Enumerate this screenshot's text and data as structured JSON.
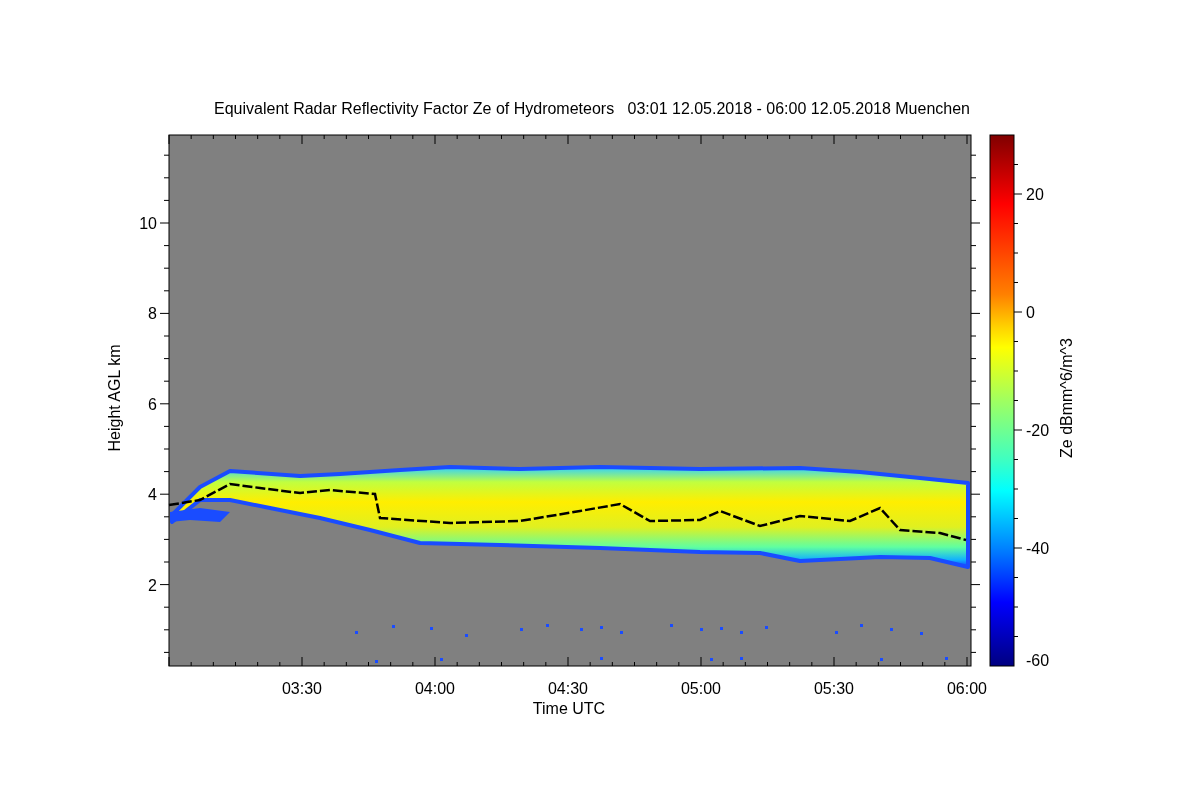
{
  "title": "Equivalent Radar Reflectivity Factor Ze of Hydrometeors   03:01 12.05.2018 - 06:00 12.05.2018 Muenchen",
  "x_axis": {
    "label": "Time UTC",
    "ticks": [
      "03:30",
      "04:00",
      "04:30",
      "05:00",
      "05:30",
      "06:00"
    ]
  },
  "y_axis": {
    "label": "Height AGL km",
    "ticks": [
      "10",
      "8",
      "6",
      "4",
      "2"
    ]
  },
  "colorbar": {
    "label": "Ze dBmm^6/m^3",
    "ticks": [
      "20",
      "0",
      "-20",
      "-40",
      "-60"
    ]
  }
}
